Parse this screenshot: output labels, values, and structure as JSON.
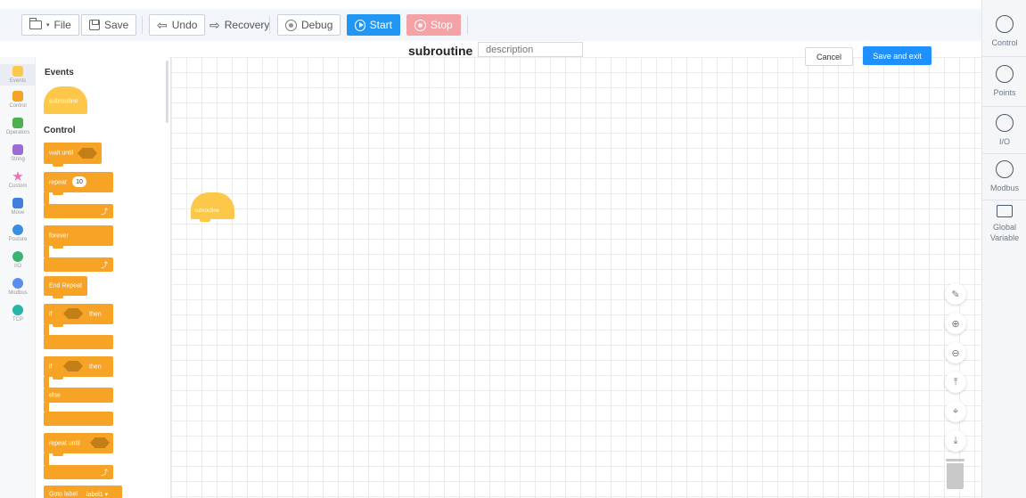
{
  "toolbar": {
    "file_label": "File",
    "save_label": "Save",
    "undo_label": "Undo",
    "recovery_label": "Recovery",
    "debug_label": "Debug",
    "start_label": "Start",
    "stop_label": "Stop"
  },
  "header": {
    "title": "subroutine",
    "description_placeholder": "description",
    "cancel_label": "Cancel",
    "save_exit_label": "Save and exit"
  },
  "categories": [
    {
      "label": "Events",
      "color": "#fdc84a"
    },
    {
      "label": "Control",
      "color": "#f7a325"
    },
    {
      "label": "Operators",
      "color": "#4caf50"
    },
    {
      "label": "String",
      "color": "#9c6bd6"
    },
    {
      "label": "Custom",
      "color": "#ef6fb5"
    },
    {
      "label": "Move",
      "color": "#3f7fe0"
    },
    {
      "label": "Posture",
      "color": "#3a8de0"
    },
    {
      "label": "I/O",
      "color": "#3cb371"
    },
    {
      "label": "Modbus",
      "color": "#5b8def"
    },
    {
      "label": "TCP",
      "color": "#28b5a8"
    }
  ],
  "flyout": {
    "events_title": "Events",
    "subroutine_label": "subroutine",
    "control_title": "Control",
    "wait_until": "wait until",
    "repeat": "repeat",
    "repeat_count": "10",
    "forever": "forever",
    "end_repeat": "End Repeat",
    "if": "if",
    "then": "then",
    "if2": "if",
    "then2": "then",
    "else": "else",
    "repeat_until": "repeat until",
    "goto_label": "Goto label",
    "label_value": "label1 ▾"
  },
  "canvas": {
    "subroutine_label": "subroutine"
  },
  "right_panel": [
    {
      "label": "Control"
    },
    {
      "label": "Points"
    },
    {
      "label": "I/O"
    },
    {
      "label": "Modbus"
    },
    {
      "label": "Global Variable"
    }
  ],
  "colors": {
    "accent": "#1e90ff",
    "event_block": "#fdc84a",
    "control_block": "#f7a325",
    "stop": "#f3a3a6"
  }
}
